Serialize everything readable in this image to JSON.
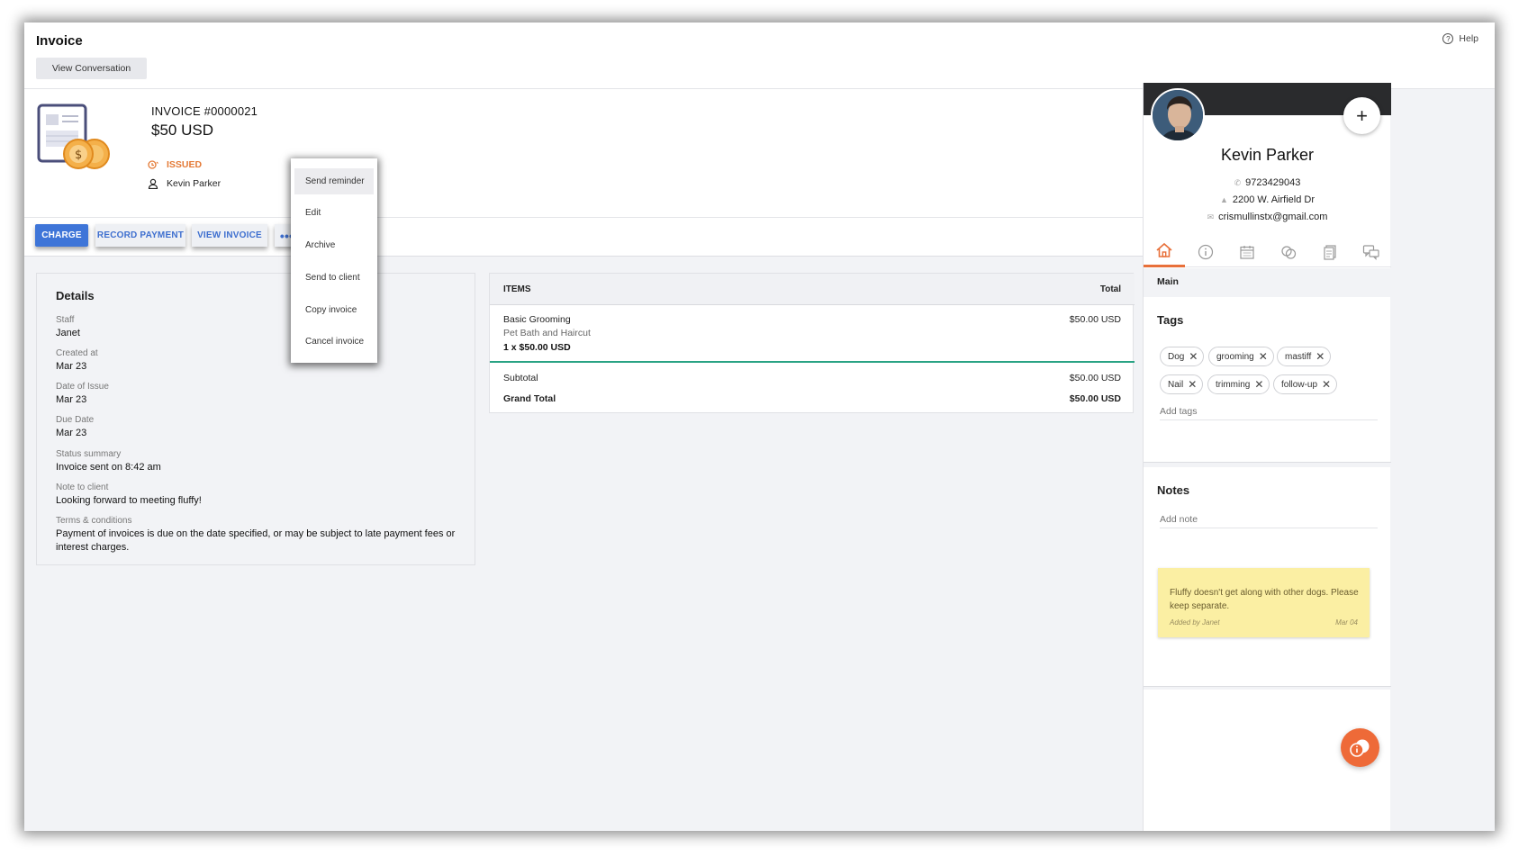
{
  "header": {
    "title": "Invoice",
    "view_conversation": "View Conversation",
    "help": "Help"
  },
  "invoice": {
    "number": "INVOICE #0000021",
    "amount": "$50 USD",
    "status": "ISSUED",
    "client": "Kevin Parker"
  },
  "actions": {
    "charge": "CHARGE",
    "record_payment": "RECORD PAYMENT",
    "view_invoice": "VIEW INVOICE",
    "more": "•••"
  },
  "menu": {
    "items": [
      "Send reminder",
      "Edit",
      "Archive",
      "Send to client",
      "Copy invoice",
      "Cancel invoice"
    ]
  },
  "details": {
    "title": "Details",
    "fields": [
      {
        "label": "Staff",
        "value": "Janet"
      },
      {
        "label": "Created at",
        "value": "Mar 23"
      },
      {
        "label": "Date of Issue",
        "value": "Mar 23"
      },
      {
        "label": "Due Date",
        "value": "Mar 23"
      },
      {
        "label": "Status summary",
        "value": "Invoice sent on 8:42 am"
      },
      {
        "label": "Note to client",
        "value": "Looking forward to meeting fluffy!"
      },
      {
        "label": "Terms & conditions",
        "value": "Payment of invoices is due on the date specified, or may be subject to late payment fees or interest charges."
      }
    ]
  },
  "items_table": {
    "col_items": "ITEMS",
    "col_total": "Total",
    "rows": [
      {
        "name": "Basic Grooming",
        "description": "Pet Bath and Haircut",
        "quantity": "1 x $50.00 USD",
        "total": "$50.00 USD"
      }
    ],
    "subtotal_label": "Subtotal",
    "subtotal_value": "$50.00 USD",
    "grand_total_label": "Grand Total",
    "grand_total_value": "$50.00 USD"
  },
  "contact": {
    "name": "Kevin Parker",
    "phone": "9723429043",
    "address": "2200 W. Airfield Dr",
    "email": "crismullinstx@gmail.com",
    "add_button": "+"
  },
  "side_tabs": {
    "icons": [
      "home-icon",
      "info-icon",
      "calendar-icon",
      "link-icon",
      "documents-icon",
      "chat-icon"
    ],
    "active_label": "Main"
  },
  "tags": {
    "title": "Tags",
    "items": [
      "Dog",
      "grooming",
      "mastiff",
      "Nail",
      "trimming",
      "follow-up"
    ],
    "placeholder": "Add tags"
  },
  "notes": {
    "title": "Notes",
    "placeholder": "Add note",
    "items": [
      {
        "text": "Fluffy doesn't get along with other dogs. Please keep separate.",
        "author": "Added by Janet",
        "date": "Mar 04"
      }
    ]
  },
  "colors": {
    "accent_blue": "#3e75d8",
    "status_orange": "#e47a36",
    "teal_divider": "#2aa384",
    "fab_orange": "#ee6a38",
    "note_yellow": "#fbefa3"
  }
}
